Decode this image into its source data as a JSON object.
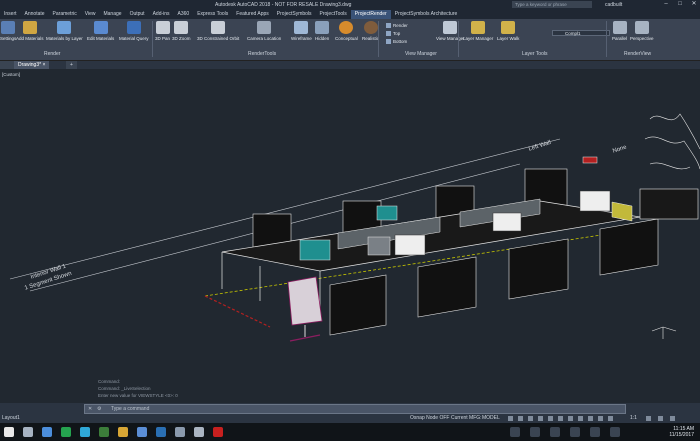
{
  "titlebar": {
    "title": "Autodesk AutoCAD 2018 - NOT FOR RESALE   Drawing3.dwg",
    "search_placeholder": "Type a keyword or phrase",
    "user": "cadbuilt"
  },
  "menu": [
    "Insert",
    "Annotate",
    "Parametric",
    "View",
    "Manage",
    "Output",
    "Add-ins",
    "A360",
    "Express Tools",
    "Featured Apps",
    "ProjectSymbols",
    "ProjectTools",
    "ProjectRender",
    "ProjectSymbols Architecture"
  ],
  "menu_active_index": 12,
  "ribbon": {
    "buttons": [
      "Settings",
      "Add Materials",
      "Materials by Layer",
      "Edit Materials",
      "Material Query",
      "3D Pan",
      "3D Zoom",
      "3D Constrained Orbit",
      "Camera Location",
      "Wireframe",
      "Hidden",
      "Conceptual",
      "Realistic",
      "View Manager",
      "Layer Manager",
      "Layer Walk",
      "Parallel",
      "Perspective"
    ],
    "panels": [
      "Render",
      "RenderTools",
      "View Manager",
      "Layer Tools",
      "RenderView"
    ],
    "view_list": [
      "Render",
      "Top",
      "Bottom"
    ],
    "layer_dropdown": "Compl1"
  },
  "tabs": [
    "Drawing3*"
  ],
  "viewport_caption": "[Custom]",
  "scene_labels": [
    "Left Wall",
    "None",
    "Interior Wall 1",
    "1 Segment Shown"
  ],
  "command_history": [
    "Command:",
    "Command: _LiveSelection",
    "Enter new value for VIEWSTYLE <0>: 0"
  ],
  "command_placeholder": "Type a command",
  "status": {
    "layout_tab": "Layout1",
    "osnap": "Osnap Node OFF",
    "current_mfg": "Current MFG:",
    "model": "MODEL",
    "scale": "1:1"
  },
  "taskbar": {
    "time": "11:15 AM",
    "date": "11/15/2017"
  },
  "colors": {
    "accent": "#3a5378",
    "canvas": "#212830",
    "desk_white": "#e8e8e8",
    "yellow": "#c8c800",
    "red": "#b32020"
  }
}
